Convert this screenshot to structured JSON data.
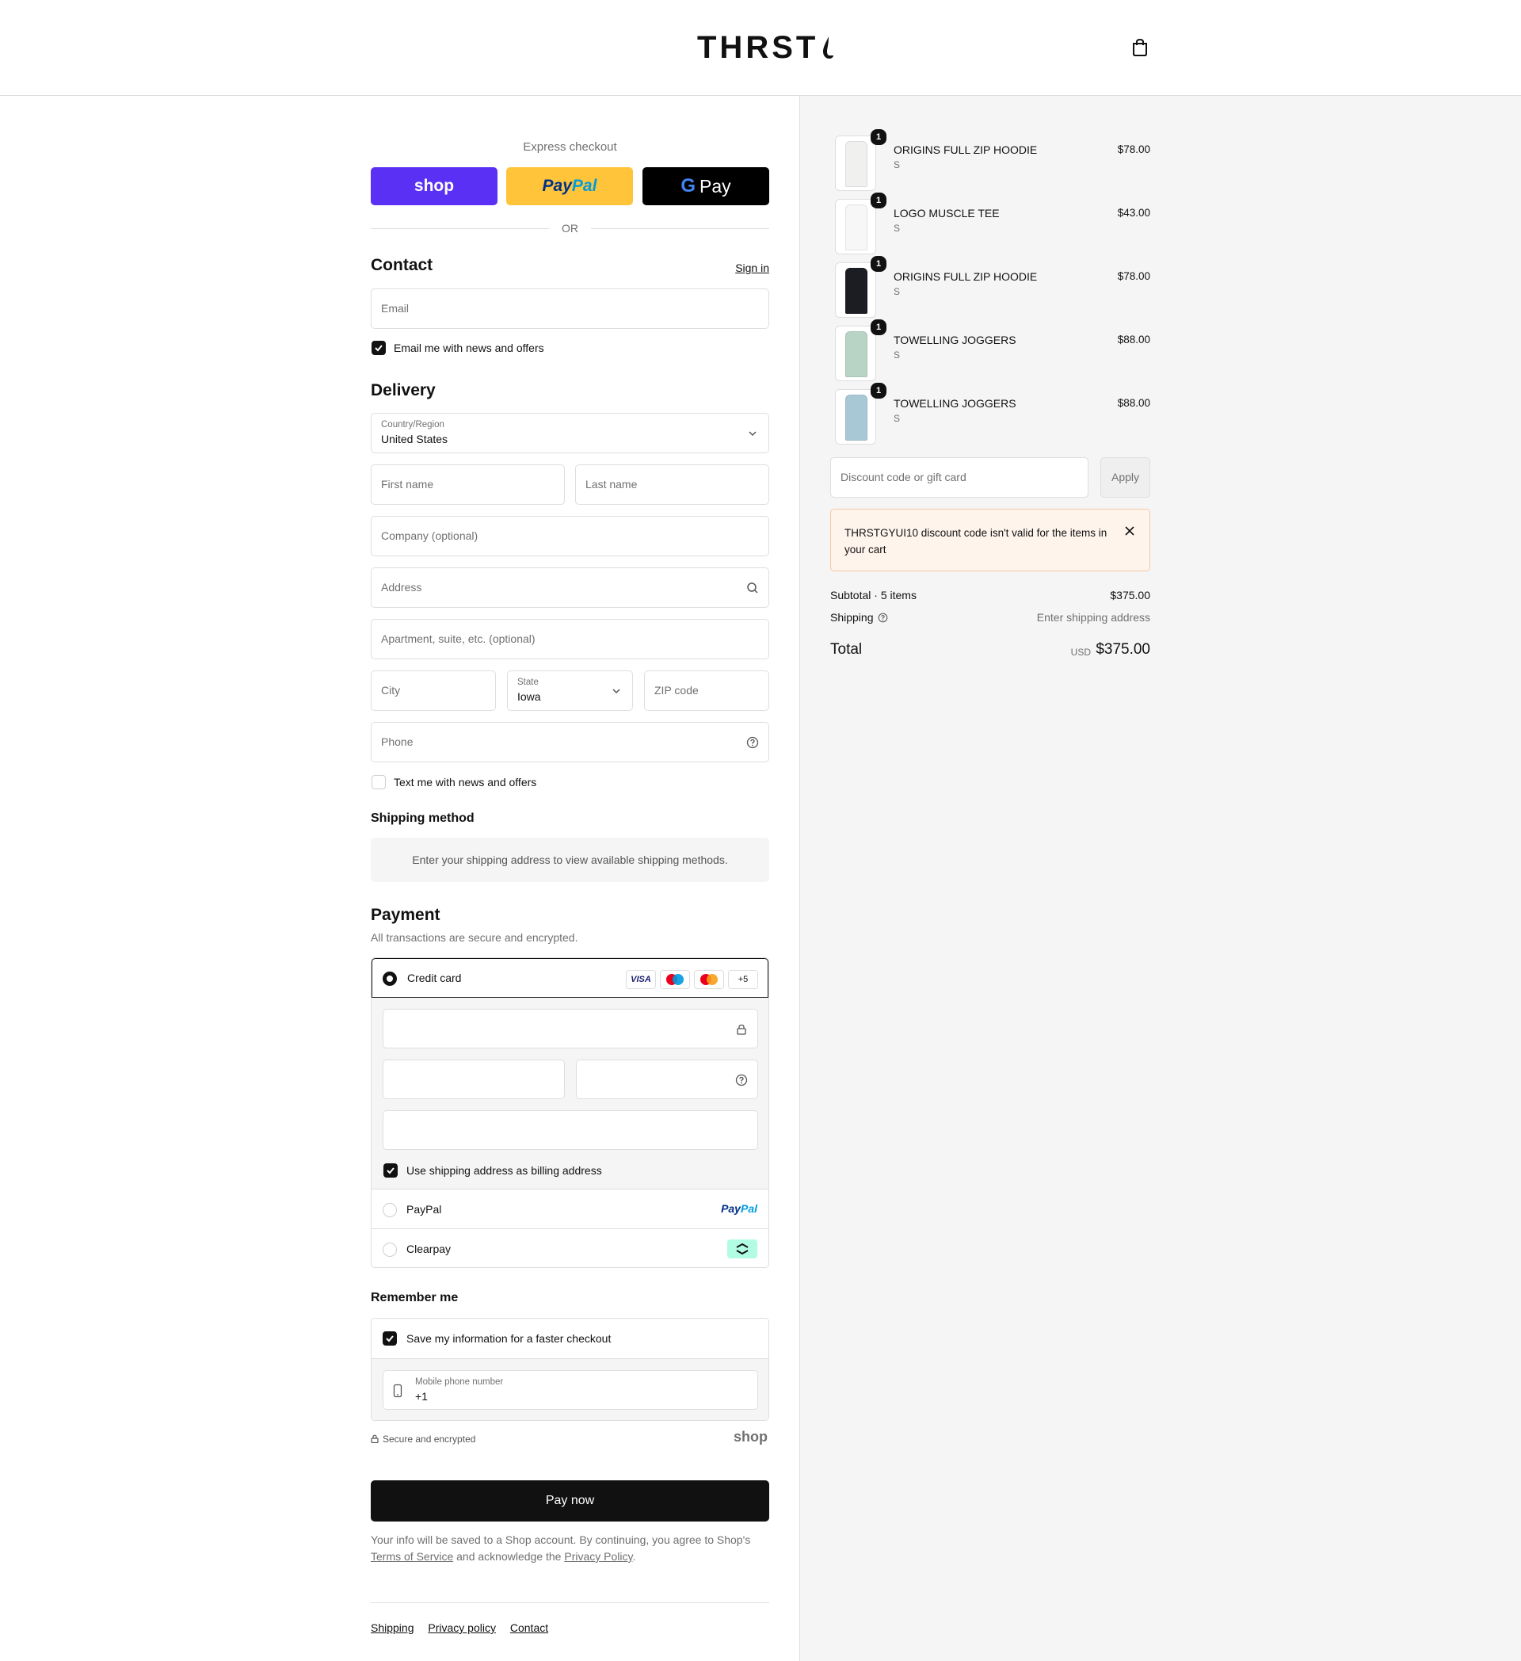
{
  "header": {
    "brand": "THRST"
  },
  "express": {
    "label": "Express checkout",
    "shop": "shop",
    "paypal_a": "Pay",
    "paypal_b": "Pal",
    "gpay": "Pay",
    "or": "OR"
  },
  "contact": {
    "title": "Contact",
    "sign_in": "Sign in",
    "email_placeholder": "Email",
    "news_label": "Email me with news and offers"
  },
  "delivery": {
    "title": "Delivery",
    "country_label": "Country/Region",
    "country_value": "United States",
    "first_name": "First name",
    "last_name": "Last name",
    "company": "Company (optional)",
    "address": "Address",
    "apartment": "Apartment, suite, etc. (optional)",
    "city": "City",
    "state_label": "State",
    "state_value": "Iowa",
    "zip": "ZIP code",
    "phone": "Phone",
    "text_label": "Text me with news and offers"
  },
  "shipping_method": {
    "title": "Shipping method",
    "message": "Enter your shipping address to view available shipping methods."
  },
  "payment": {
    "title": "Payment",
    "subtitle": "All transactions are secure and encrypted.",
    "credit_card": "Credit card",
    "visa": "VISA",
    "more_cards": "+5",
    "billing_label": "Use shipping address as billing address",
    "paypal": "PayPal",
    "paypal_logo_a": "Pay",
    "paypal_logo_b": "Pal",
    "clearpay": "Clearpay"
  },
  "remember": {
    "title": "Remember me",
    "save_label": "Save my information for a faster checkout",
    "mobile_label": "Mobile phone number",
    "mobile_value": "+1",
    "secure": "Secure and encrypted",
    "shop": "shop"
  },
  "pay_now": "Pay now",
  "legal": {
    "text1": "Your info will be saved to a Shop account. By continuing, you agree to Shop's",
    "tos": "Terms of Service",
    "text2": "and acknowledge the",
    "privacy": "Privacy Policy",
    "period": "."
  },
  "footer": {
    "shipping": "Shipping",
    "privacy": "Privacy policy",
    "contact": "Contact"
  },
  "cart": {
    "items": [
      {
        "name": "ORIGINS FULL ZIP HOODIE",
        "variant": "S",
        "price": "$78.00",
        "qty": "1",
        "color": "#f0f0ee"
      },
      {
        "name": "LOGO MUSCLE TEE",
        "variant": "S",
        "price": "$43.00",
        "qty": "1",
        "color": "#f7f7f7"
      },
      {
        "name": "ORIGINS FULL ZIP HOODIE",
        "variant": "S",
        "price": "$78.00",
        "qty": "1",
        "color": "#1b1d22"
      },
      {
        "name": "TOWELLING JOGGERS",
        "variant": "S",
        "price": "$88.00",
        "qty": "1",
        "color": "#b8d4c4"
      },
      {
        "name": "TOWELLING JOGGERS",
        "variant": "S",
        "price": "$88.00",
        "qty": "1",
        "color": "#a9c8d6"
      }
    ],
    "discount_placeholder": "Discount code or gift card",
    "apply": "Apply",
    "alert": "THRSTGYUI10 discount code isn't valid for the items in your cart",
    "subtotal_label": "Subtotal · 5 items",
    "subtotal": "$375.00",
    "shipping_label": "Shipping",
    "shipping_value": "Enter shipping address",
    "total_label": "Total",
    "currency": "USD",
    "total": "$375.00"
  }
}
